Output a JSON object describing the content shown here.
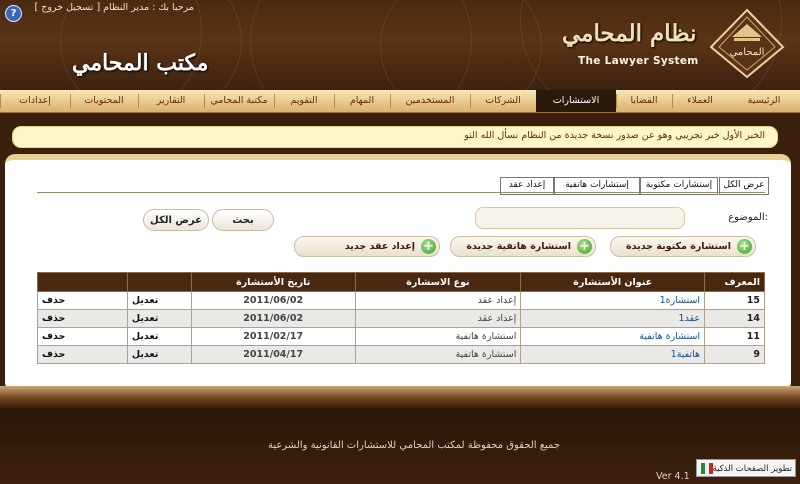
{
  "header": {
    "greeting": "مرحبا بك : مدير النظام [ تسجيل خروج ]",
    "office_title": "مكتب المحامي",
    "brand_ar": "نظام المحامي",
    "brand_en": "The Lawyer System",
    "logo_text": "المحامي",
    "help_glyph": "?"
  },
  "nav": {
    "items": [
      {
        "label": "الرئيسية",
        "active": false
      },
      {
        "label": "العملاء",
        "active": false
      },
      {
        "label": "القضايا",
        "active": false
      },
      {
        "label": "الاستشارات",
        "active": true
      },
      {
        "label": "الشركات",
        "active": false
      },
      {
        "label": "المستخدمين",
        "active": false
      },
      {
        "label": "المهام",
        "active": false
      },
      {
        "label": "التقويم",
        "active": false
      },
      {
        "label": "مكتبة المحامي",
        "active": false
      },
      {
        "label": "التقارير",
        "active": false
      },
      {
        "label": "المحتويات",
        "active": false
      },
      {
        "label": "إعدادات",
        "active": false
      }
    ]
  },
  "ticker": {
    "text": "الخبر الأول خبر تجريبي وهو عن صدور نسخة جديدة من النظام نسأل الله التو"
  },
  "tabs": [
    {
      "label": "عرض الكل"
    },
    {
      "label": "إستشارات مكتوبة"
    },
    {
      "label": "إستشارات هاتفية"
    },
    {
      "label": "إعداد عقد"
    }
  ],
  "search": {
    "subject_label": "الموضوع:",
    "subject_value": "",
    "search_label": "بحث",
    "show_all_label": "عرض الكل"
  },
  "actions": {
    "new_written": "استشارة مكتوبة جديدة",
    "new_phone": "استشارة هاتفية جديدة",
    "new_contract": "إعداد عقد جديد"
  },
  "table": {
    "headers": {
      "id": "المعرف",
      "title": "عنوان الأستشارة",
      "type": "نوع الاسشارة",
      "date": "تاريخ الأستشارة"
    },
    "rows": [
      {
        "id": "15",
        "title": "استشارة1",
        "type": "إعداد عقد",
        "date": "2011/06/02",
        "edit": "تعديل",
        "delete": "حذف"
      },
      {
        "id": "14",
        "title": "عقد1",
        "type": "إعداد عقد",
        "date": "2011/06/02",
        "edit": "تعديل",
        "delete": "حذف"
      },
      {
        "id": "11",
        "title": "استشارة هاتفية",
        "type": "استشارة هاتفية",
        "date": "2011/02/17",
        "edit": "تعديل",
        "delete": "حذف"
      },
      {
        "id": "9",
        "title": "هاتفية1",
        "type": "استشارة هاتفية",
        "date": "2011/04/17",
        "edit": "تعديل",
        "delete": "حذف"
      }
    ]
  },
  "footer": {
    "copyright": "جميع الحقوق محفوظة لمكتب المحامي للاستشارات القانونية والشرعية",
    "version": "Ver 4.1",
    "developer": "تطوير الصفحات الذكية"
  },
  "colors": {
    "header_bg": "#4a2a12",
    "nav_bg": "#e8c98c",
    "nav_active": "#2a1a0a",
    "table_header": "#4a2810",
    "link": "#1a4f9a",
    "plus_green": "#3f9a2a"
  }
}
